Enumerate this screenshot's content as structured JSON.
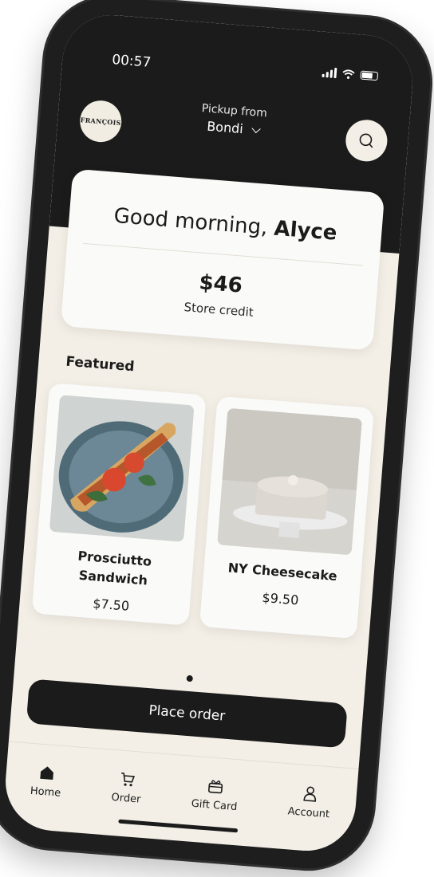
{
  "status": {
    "time": "00:57"
  },
  "header": {
    "logo_text": "FRANÇOIS",
    "pickup_label": "Pickup from",
    "location": "Bondi",
    "icons": [
      "search-icon",
      "chevron-down-icon"
    ]
  },
  "greeting": {
    "prefix": "Good morning,",
    "name": "Alyce"
  },
  "credit": {
    "amount": "$46",
    "label": "Store credit"
  },
  "featured": {
    "title": "Featured",
    "items": [
      {
        "name": "Prosciutto Sandwich",
        "price": "$7.50"
      },
      {
        "name": "NY Cheesecake",
        "price": "$9.50"
      }
    ]
  },
  "actions": {
    "place_order": "Place order"
  },
  "tabs": [
    {
      "label": "Home",
      "icon": "home-icon"
    },
    {
      "label": "Order",
      "icon": "cart-icon"
    },
    {
      "label": "Gift Card",
      "icon": "gift-icon"
    },
    {
      "label": "Account",
      "icon": "account-icon"
    }
  ],
  "colors": {
    "dark": "#1b1b1b",
    "cream": "#f3efe6",
    "card": "#fafaf8"
  }
}
